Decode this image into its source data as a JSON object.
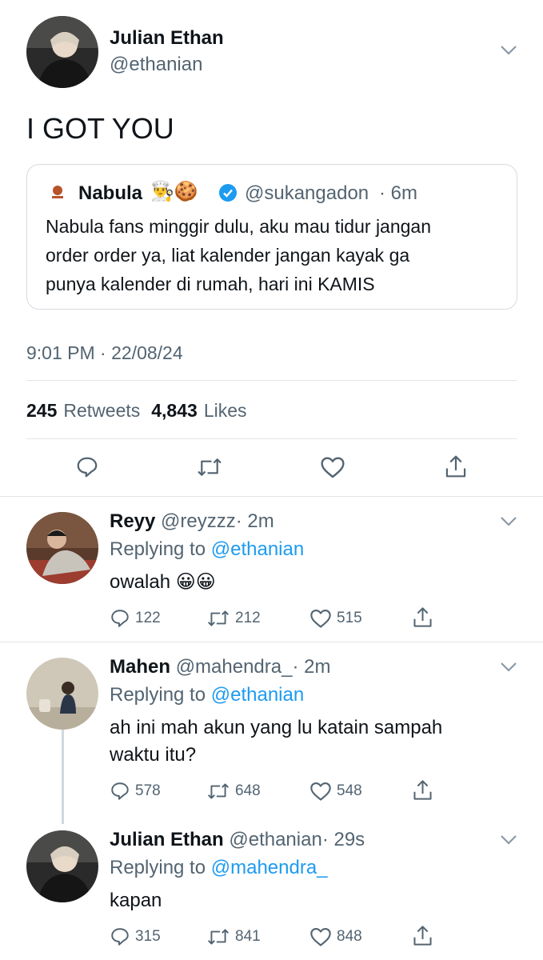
{
  "main_tweet": {
    "name": "Julian Ethan",
    "handle": "@ethanian",
    "text": "I GOT YOU",
    "quote": {
      "name": "Nabula",
      "emojis": "👨‍🍳🍪",
      "handle": "@sukangadon",
      "time": "· 6m",
      "text_line1": "Nabula fans minggir dulu, aku mau tidur jangan",
      "text_line2": "order order ya, liat kalender jangan kayak ga",
      "text_line3": "punya kalender di rumah, hari ini KAMIS"
    },
    "timestamp": "9:01 PM · 22/08/24",
    "retweets_count": "245",
    "retweets_label": "Retweets",
    "likes_count": "4,843",
    "likes_label": "Likes"
  },
  "replies": [
    {
      "name": "Reyy",
      "handle": "@reyzzz",
      "time": "· 2m",
      "replying_label": "Replying to",
      "replying_to": "@ethanian",
      "text": "owalah 😀😀",
      "replies": "122",
      "retweets": "212",
      "likes": "515"
    },
    {
      "name": "Mahen",
      "handle": "@mahendra_",
      "time": "· 2m",
      "replying_label": "Replying to",
      "replying_to": "@ethanian",
      "text_line1": "ah ini mah akun yang lu katain sampah",
      "text_line2": "waktu itu?",
      "replies": "578",
      "retweets": "648",
      "likes": "548"
    },
    {
      "name": "Julian Ethan",
      "handle": "@ethanian",
      "time": "· 29s",
      "replying_label": "Replying to",
      "replying_to": "@mahendra_",
      "text": "kapan",
      "replies": "315",
      "retweets": "841",
      "likes": "848"
    }
  ],
  "colors": {
    "accent": "#1d9bf0",
    "verified": "#1d9bf0",
    "secondary_text": "#536471",
    "divider": "#e1e4e8"
  },
  "icons": [
    "chevron-down-icon",
    "reply-icon",
    "retweet-icon",
    "like-icon",
    "share-icon",
    "verified-icon"
  ]
}
